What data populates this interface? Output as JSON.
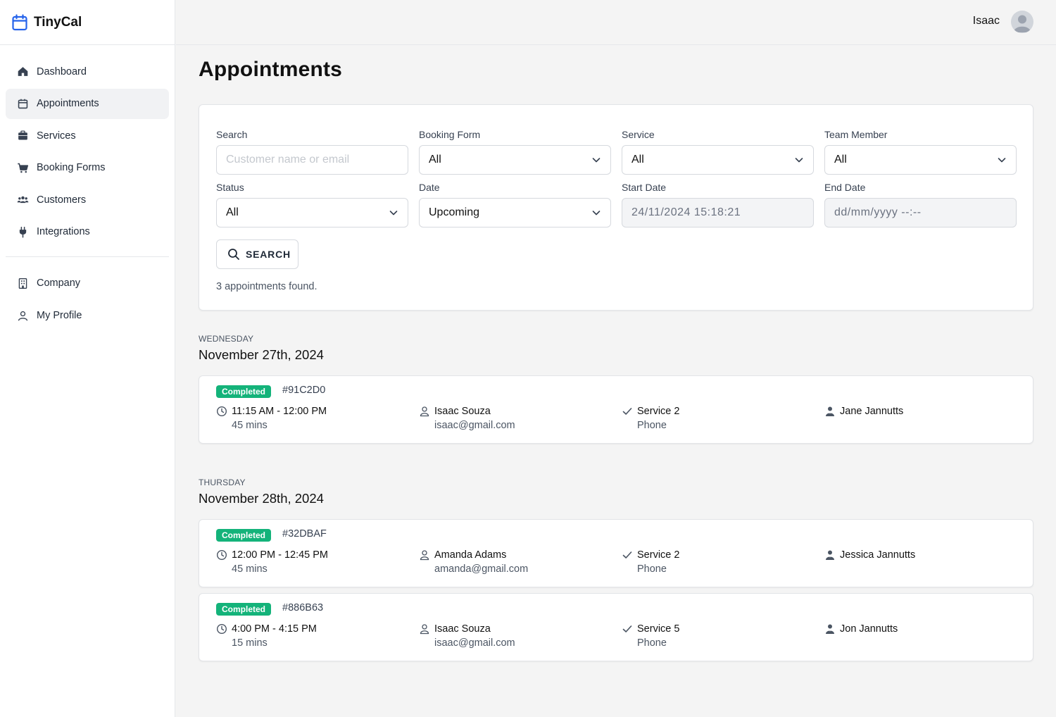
{
  "brand": {
    "name": "TinyCal",
    "accent": "#2563eb"
  },
  "sidebar": {
    "items": [
      {
        "label": "Dashboard",
        "icon": "home-icon"
      },
      {
        "label": "Appointments",
        "icon": "calendar-icon",
        "active": true
      },
      {
        "label": "Services",
        "icon": "briefcase-icon"
      },
      {
        "label": "Booking Forms",
        "icon": "cart-icon"
      },
      {
        "label": "Customers",
        "icon": "users-icon"
      },
      {
        "label": "Integrations",
        "icon": "plug-icon"
      }
    ],
    "bottom_items": [
      {
        "label": "Company",
        "icon": "building-icon"
      },
      {
        "label": "My Profile",
        "icon": "user-icon"
      }
    ]
  },
  "topbar": {
    "user_name": "Isaac"
  },
  "page": {
    "title": "Appointments"
  },
  "filters": {
    "search": {
      "label": "Search",
      "placeholder": "Customer name or email",
      "value": ""
    },
    "booking_form": {
      "label": "Booking Form",
      "value": "All"
    },
    "service": {
      "label": "Service",
      "value": "All"
    },
    "team_member": {
      "label": "Team Member",
      "value": "All"
    },
    "status": {
      "label": "Status",
      "value": "All"
    },
    "date": {
      "label": "Date",
      "value": "Upcoming"
    },
    "start_date": {
      "label": "Start Date",
      "value": "24/11/2024 15:18:21"
    },
    "end_date": {
      "label": "End Date",
      "placeholder": "dd/mm/yyyy --:--"
    },
    "search_button": "SEARCH",
    "result_text": "3 appointments found."
  },
  "days": [
    {
      "weekday": "WEDNESDAY",
      "date": "November 27th, 2024",
      "appointments": [
        {
          "status": "Completed",
          "id": "91C2D0",
          "time": "11:15 AM - 12:00 PM",
          "duration": "45 mins",
          "customer": "Isaac Souza",
          "email": "isaac@gmail.com",
          "service": "Service 2",
          "channel": "Phone",
          "member": "Jane Jannutts"
        }
      ]
    },
    {
      "weekday": "THURSDAY",
      "date": "November 28th, 2024",
      "appointments": [
        {
          "status": "Completed",
          "id": "32DBAF",
          "time": "12:00 PM - 12:45 PM",
          "duration": "45 mins",
          "customer": "Amanda Adams",
          "email": "amanda@gmail.com",
          "service": "Service 2",
          "channel": "Phone",
          "member": "Jessica Jannutts"
        },
        {
          "status": "Completed",
          "id": "886B63",
          "time": "4:00 PM - 4:15 PM",
          "duration": "15 mins",
          "customer": "Isaac Souza",
          "email": "isaac@gmail.com",
          "service": "Service 5",
          "channel": "Phone",
          "member": "Jon Jannutts"
        }
      ]
    }
  ],
  "colors": {
    "status_completed": "#14b37a"
  }
}
